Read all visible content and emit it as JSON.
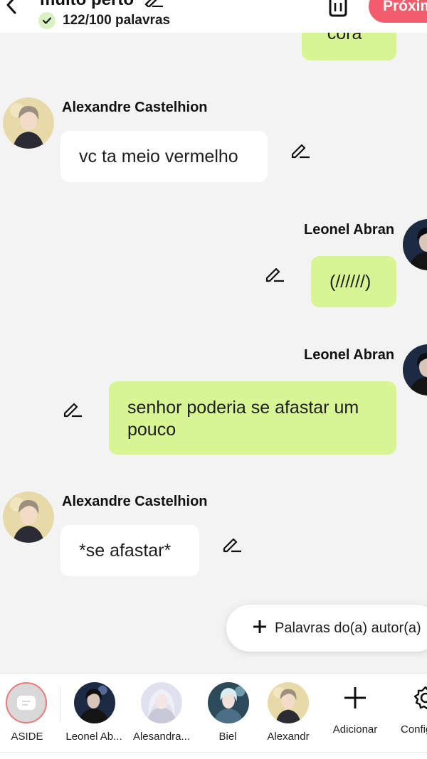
{
  "header": {
    "title": "muito perto",
    "word_count": "122/100 palavras",
    "next_label": "Próximo"
  },
  "messages": [
    {
      "speaker": "Leonel Abran",
      "side": "right",
      "text": "*cora"
    },
    {
      "speaker": "Alexandre Castelhion",
      "side": "left",
      "text": "vc ta meio vermelho"
    },
    {
      "speaker": "Leonel Abran",
      "side": "right",
      "text": "(//////)"
    },
    {
      "speaker": "Leonel Abran",
      "side": "right",
      "text": "senhor poderia se afastar um pouco"
    },
    {
      "speaker": "Alexandre Castelhion",
      "side": "left",
      "text": "*se afastar*"
    }
  ],
  "add_author_words": "Palavras do(a) autor(a)",
  "characters": [
    {
      "label": "ASIDE"
    },
    {
      "label": "Leonel Ab..."
    },
    {
      "label": "Alesandra..."
    },
    {
      "label": "Biel"
    },
    {
      "label": "Alexandr"
    }
  ],
  "actions": {
    "add_label": "Adicionar",
    "settings_label": "Configurações"
  },
  "colors": {
    "accent": "#f25c6c",
    "my_bubble": "#d7f592",
    "other_bubble": "#ffffff",
    "background": "#f3f3f3"
  }
}
